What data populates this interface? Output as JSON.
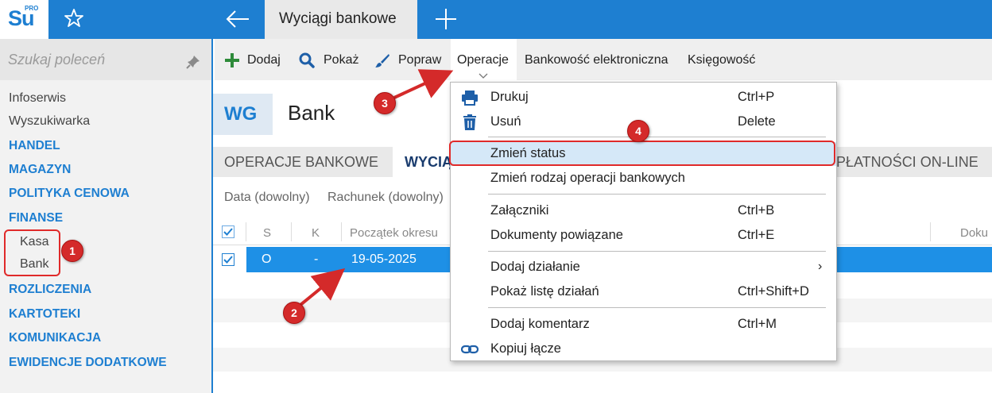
{
  "app": {
    "logo_text": "Su",
    "logo_sup": "PRO",
    "active_tab": "Wyciągi bankowe"
  },
  "sidebar": {
    "search_placeholder": "Szukaj poleceń",
    "items": [
      {
        "label": "Infoserwis",
        "type": "plain"
      },
      {
        "label": "Wyszukiwarka",
        "type": "plain"
      },
      {
        "label": "HANDEL",
        "type": "section"
      },
      {
        "label": "MAGAZYN",
        "type": "section"
      },
      {
        "label": "POLITYKA CENOWA",
        "type": "section"
      },
      {
        "label": "FINANSE",
        "type": "section"
      },
      {
        "label": "Kasa",
        "type": "sub"
      },
      {
        "label": "Bank",
        "type": "sub"
      },
      {
        "label": "ROZLICZENIA",
        "type": "section"
      },
      {
        "label": "KARTOTEKI",
        "type": "section"
      },
      {
        "label": "KOMUNIKACJA",
        "type": "section"
      },
      {
        "label": "EWIDENCJE DODATKOWE",
        "type": "section"
      }
    ]
  },
  "toolbar": {
    "add": "Dodaj",
    "show": "Pokaż",
    "edit": "Popraw",
    "operations": "Operacje",
    "ebanking": "Bankowość elektroniczna",
    "accounting": "Księgowość"
  },
  "header": {
    "badge": "WG",
    "title": "Bank"
  },
  "tabs": {
    "operations": "OPERACJE BANKOWE",
    "statements": "WYCIĄ",
    "online": "PŁATNOŚCI ON-LINE"
  },
  "filters": {
    "date": "Data (dowolny)",
    "account": "Rachunek (dowolny)"
  },
  "grid": {
    "columns": [
      "S",
      "K",
      "Początek okresu",
      "Doku"
    ],
    "rows": [
      {
        "s": "O",
        "k": "-",
        "start": "19-05-2025"
      }
    ]
  },
  "context_menu": {
    "items": [
      {
        "label": "Drukuj",
        "shortcut": "Ctrl+P"
      },
      {
        "label": "Usuń",
        "shortcut": "Delete"
      },
      {
        "label": "Zmień status",
        "shortcut": ""
      },
      {
        "label": "Zmień rodzaj operacji bankowych",
        "shortcut": ""
      },
      {
        "label": "Załączniki",
        "shortcut": "Ctrl+B"
      },
      {
        "label": "Dokumenty powiązane",
        "shortcut": "Ctrl+E"
      },
      {
        "label": "Dodaj działanie",
        "shortcut": "›"
      },
      {
        "label": "Pokaż listę działań",
        "shortcut": "Ctrl+Shift+D"
      },
      {
        "label": "Dodaj komentarz",
        "shortcut": "Ctrl+M"
      },
      {
        "label": "Kopiuj łącze",
        "shortcut": ""
      }
    ]
  },
  "annotations": [
    "1",
    "2",
    "3",
    "4"
  ],
  "colors": {
    "brand_blue": "#1e7fd1",
    "selection_blue": "#1e90e6",
    "annotation_red": "#d42a2a",
    "menu_highlight": "#d5e8f8"
  }
}
